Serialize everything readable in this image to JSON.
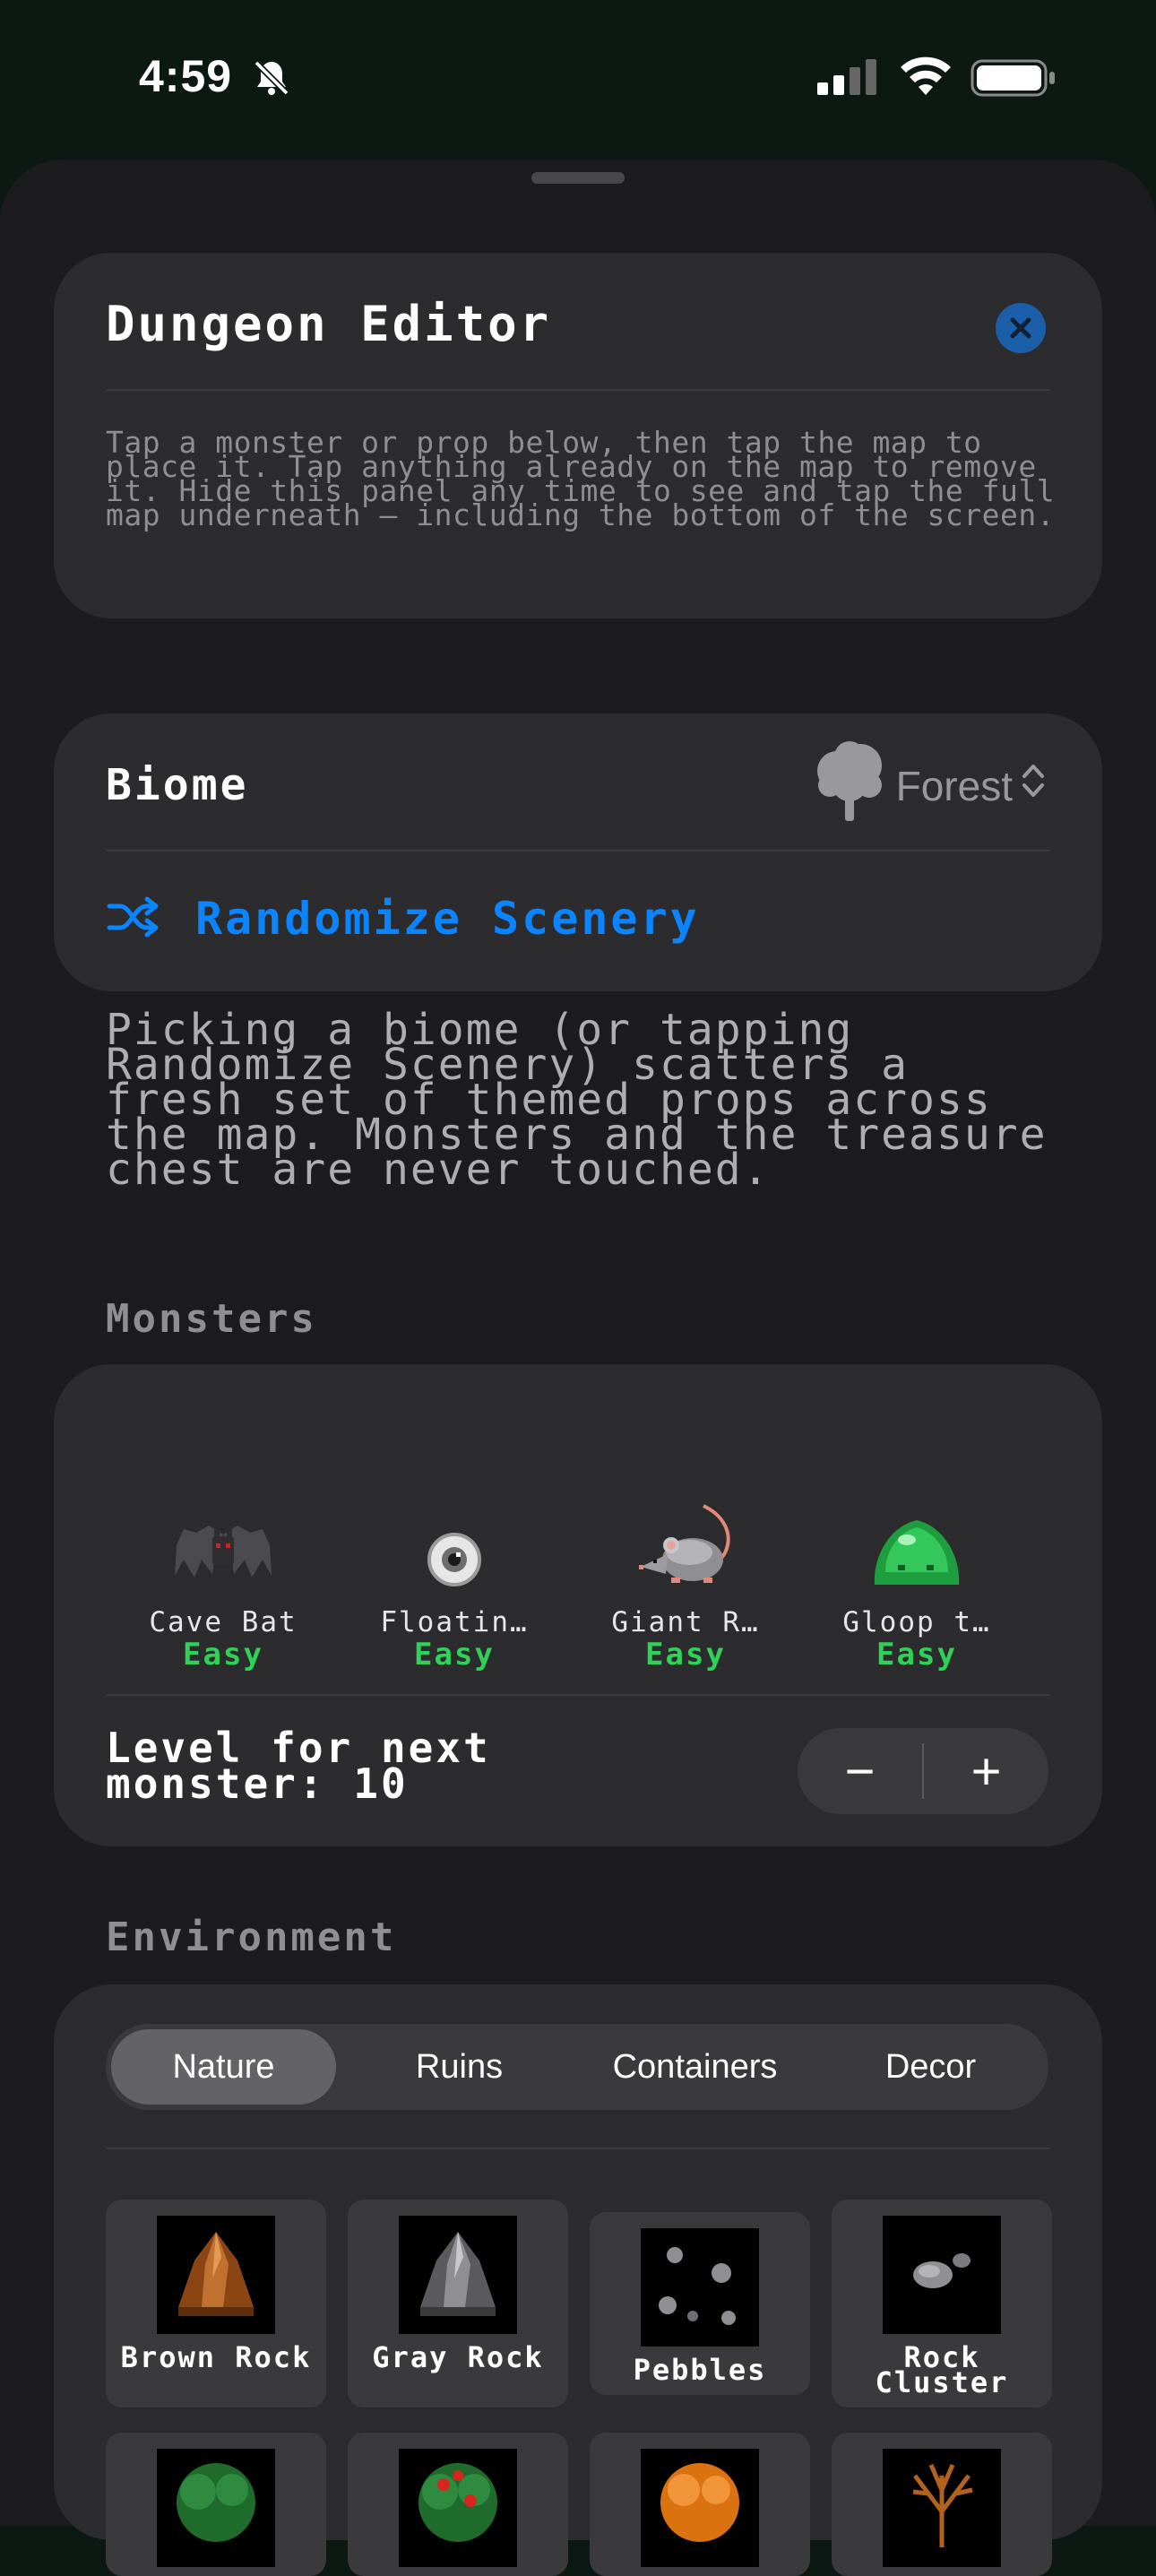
{
  "status": {
    "time": "4:59"
  },
  "editor": {
    "title": "Dungeon Editor",
    "description": "Tap a monster or prop below, then tap the map to place it. Tap anything already on the map to remove it. Hide this panel any time to see and tap the full map underneath — including the bottom of the screen."
  },
  "biome": {
    "label": "Biome",
    "selected": "Forest",
    "randomize_label": "Randomize Scenery",
    "help": "Picking a biome (or tapping Randomize Scenery) scatters a fresh set of themed props across the map. Monsters and the treasure chest are never touched."
  },
  "monsters": {
    "section_label": "Monsters",
    "items": [
      {
        "name": "Cave Bat",
        "difficulty": "Easy"
      },
      {
        "name": "Floatin…",
        "difficulty": "Easy"
      },
      {
        "name": "Giant R…",
        "difficulty": "Easy"
      },
      {
        "name": "Gloop t…",
        "difficulty": "Easy"
      }
    ],
    "level_label": "Level for next monster: 10",
    "minus": "−",
    "plus": "+"
  },
  "environment": {
    "section_label": "Environment",
    "tabs": [
      "Nature",
      "Ruins",
      "Containers",
      "Decor"
    ],
    "active_tab": "Nature",
    "items": [
      {
        "name": "Brown Rock"
      },
      {
        "name": "Gray Rock"
      },
      {
        "name": "Pebbles"
      },
      {
        "name": "Rock Cluster"
      }
    ]
  },
  "colors": {
    "accent": "#0a84ff",
    "easy": "#30d158",
    "card": "#2c2c2e",
    "sheet": "#1c1c1e"
  },
  "icons": [
    "bell-slash-icon",
    "signal-icon",
    "wifi-icon",
    "battery-icon",
    "close-icon",
    "tree-icon",
    "chevron-updown-icon",
    "shuffle-icon"
  ]
}
